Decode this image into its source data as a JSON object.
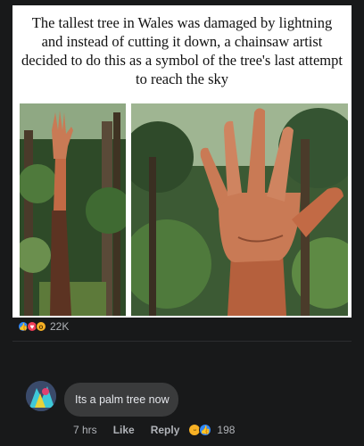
{
  "post": {
    "caption": "The tallest tree in Wales was damaged by lightning and instead of cutting it down, a chainsaw artist decided to do this as a symbol of the tree's last attempt to reach the sky"
  },
  "reactions": {
    "icons": [
      "like-icon",
      "love-icon",
      "wow-icon"
    ],
    "count": "22K"
  },
  "comment": {
    "text": "Its a palm tree now",
    "time": "7 hrs",
    "like_label": "Like",
    "reply_label": "Reply",
    "reaction_icons": [
      "haha-icon",
      "like-icon"
    ],
    "reaction_count": "198"
  },
  "colors": {
    "background": "#18191a",
    "bubble": "#3a3b3c",
    "like_blue": "#2d88ff",
    "love_red": "#f33e58",
    "wow_yellow": "#f7b125"
  }
}
